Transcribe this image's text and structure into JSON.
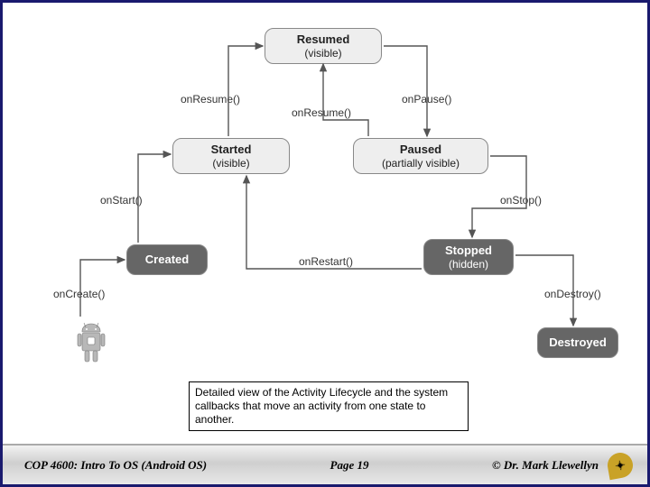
{
  "diagram": {
    "states": {
      "resumed": {
        "title": "Resumed",
        "sub": "(visible)"
      },
      "started": {
        "title": "Started",
        "sub": "(visible)"
      },
      "paused": {
        "title": "Paused",
        "sub": "(partially visible)"
      },
      "created": {
        "title": "Created",
        "sub": ""
      },
      "stopped": {
        "title": "Stopped",
        "sub": "(hidden)"
      },
      "destroyed": {
        "title": "Destroyed",
        "sub": ""
      }
    },
    "edges": {
      "onCreate": "onCreate()",
      "onStart": "onStart()",
      "onResume1": "onResume()",
      "onResume2": "onResume()",
      "onPause": "onPause()",
      "onStop": "onStop()",
      "onRestart": "onRestart()",
      "onDestroy": "onDestroy()"
    }
  },
  "caption": "Detailed view of the Activity Lifecycle and the system callbacks that move an activity from one state to another.",
  "footer": {
    "course": "COP 4600: Intro To OS  (Android OS)",
    "page": "Page 19",
    "author": "© Dr. Mark Llewellyn"
  },
  "chart_data": {
    "type": "state-diagram",
    "title": "Android Activity Lifecycle",
    "nodes": [
      {
        "id": "created",
        "label": "Created"
      },
      {
        "id": "started",
        "label": "Started (visible)"
      },
      {
        "id": "resumed",
        "label": "Resumed (visible)"
      },
      {
        "id": "paused",
        "label": "Paused (partially visible)"
      },
      {
        "id": "stopped",
        "label": "Stopped (hidden)"
      },
      {
        "id": "destroyed",
        "label": "Destroyed"
      }
    ],
    "edges": [
      {
        "from": "init",
        "to": "created",
        "label": "onCreate()"
      },
      {
        "from": "created",
        "to": "started",
        "label": "onStart()"
      },
      {
        "from": "started",
        "to": "resumed",
        "label": "onResume()"
      },
      {
        "from": "resumed",
        "to": "paused",
        "label": "onPause()"
      },
      {
        "from": "paused",
        "to": "resumed",
        "label": "onResume()"
      },
      {
        "from": "paused",
        "to": "stopped",
        "label": "onStop()"
      },
      {
        "from": "stopped",
        "to": "started",
        "label": "onRestart()"
      },
      {
        "from": "stopped",
        "to": "destroyed",
        "label": "onDestroy()"
      }
    ]
  }
}
